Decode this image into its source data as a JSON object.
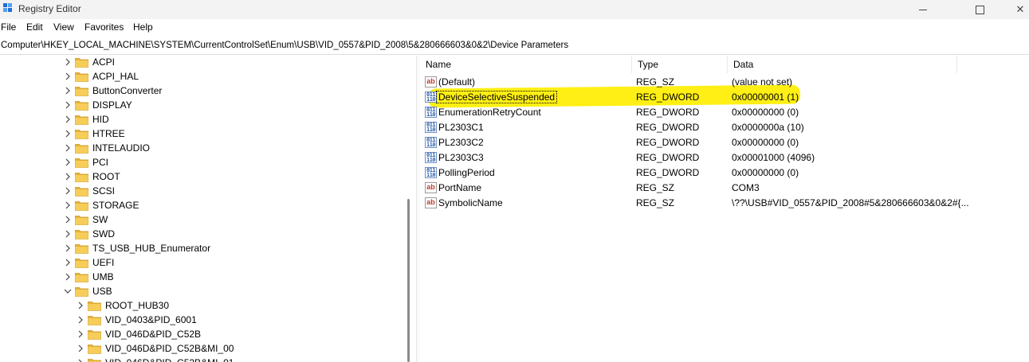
{
  "window": {
    "title": "Registry Editor"
  },
  "menu": [
    "File",
    "Edit",
    "View",
    "Favorites",
    "Help"
  ],
  "address": "Computer\\HKEY_LOCAL_MACHINE\\SYSTEM\\CurrentControlSet\\Enum\\USB\\VID_0557&PID_2008\\5&280666603&0&2\\Device Parameters",
  "tree": {
    "items": [
      {
        "label": "ACPI",
        "level": 0,
        "expanded": false
      },
      {
        "label": "ACPI_HAL",
        "level": 0,
        "expanded": false
      },
      {
        "label": "ButtonConverter",
        "level": 0,
        "expanded": false
      },
      {
        "label": "DISPLAY",
        "level": 0,
        "expanded": false
      },
      {
        "label": "HID",
        "level": 0,
        "expanded": false
      },
      {
        "label": "HTREE",
        "level": 0,
        "expanded": false
      },
      {
        "label": "INTELAUDIO",
        "level": 0,
        "expanded": false
      },
      {
        "label": "PCI",
        "level": 0,
        "expanded": false
      },
      {
        "label": "ROOT",
        "level": 0,
        "expanded": false
      },
      {
        "label": "SCSI",
        "level": 0,
        "expanded": false
      },
      {
        "label": "STORAGE",
        "level": 0,
        "expanded": false
      },
      {
        "label": "SW",
        "level": 0,
        "expanded": false
      },
      {
        "label": "SWD",
        "level": 0,
        "expanded": false
      },
      {
        "label": "TS_USB_HUB_Enumerator",
        "level": 0,
        "expanded": false
      },
      {
        "label": "UEFI",
        "level": 0,
        "expanded": false
      },
      {
        "label": "UMB",
        "level": 0,
        "expanded": false
      },
      {
        "label": "USB",
        "level": 0,
        "expanded": true
      },
      {
        "label": "ROOT_HUB30",
        "level": 1,
        "expanded": false
      },
      {
        "label": "VID_0403&PID_6001",
        "level": 1,
        "expanded": false
      },
      {
        "label": "VID_046D&PID_C52B",
        "level": 1,
        "expanded": false
      },
      {
        "label": "VID_046D&PID_C52B&MI_00",
        "level": 1,
        "expanded": false
      },
      {
        "label": "VID_046D&PID_C52B&MI_01",
        "level": 1,
        "expanded": false
      }
    ]
  },
  "columns": {
    "name": "Name",
    "type": "Type",
    "data": "Data"
  },
  "values": [
    {
      "name": "(Default)",
      "type": "REG_SZ",
      "data": "(value not set)",
      "icon": "string-value-icon"
    },
    {
      "name": "DeviceSelectiveSuspended",
      "type": "REG_DWORD",
      "data": "0x00000001 (1)",
      "icon": "binary-value-icon",
      "highlighted": true
    },
    {
      "name": "EnumerationRetryCount",
      "type": "REG_DWORD",
      "data": "0x00000000 (0)",
      "icon": "binary-value-icon"
    },
    {
      "name": "PL2303C1",
      "type": "REG_DWORD",
      "data": "0x0000000a (10)",
      "icon": "binary-value-icon"
    },
    {
      "name": "PL2303C2",
      "type": "REG_DWORD",
      "data": "0x00000000 (0)",
      "icon": "binary-value-icon"
    },
    {
      "name": "PL2303C3",
      "type": "REG_DWORD",
      "data": "0x00001000 (4096)",
      "icon": "binary-value-icon"
    },
    {
      "name": "PollingPeriod",
      "type": "REG_DWORD",
      "data": "0x00000000 (0)",
      "icon": "binary-value-icon"
    },
    {
      "name": "PortName",
      "type": "REG_SZ",
      "data": "COM3",
      "icon": "string-value-icon"
    },
    {
      "name": "SymbolicName",
      "type": "REG_SZ",
      "data": "\\??\\USB#VID_0557&PID_2008#5&280666603&0&2#{...",
      "icon": "string-value-icon"
    }
  ],
  "colors": {
    "highlight": "#ffee00",
    "folder": "#f2c04a",
    "accent": "#1e6fd9"
  }
}
